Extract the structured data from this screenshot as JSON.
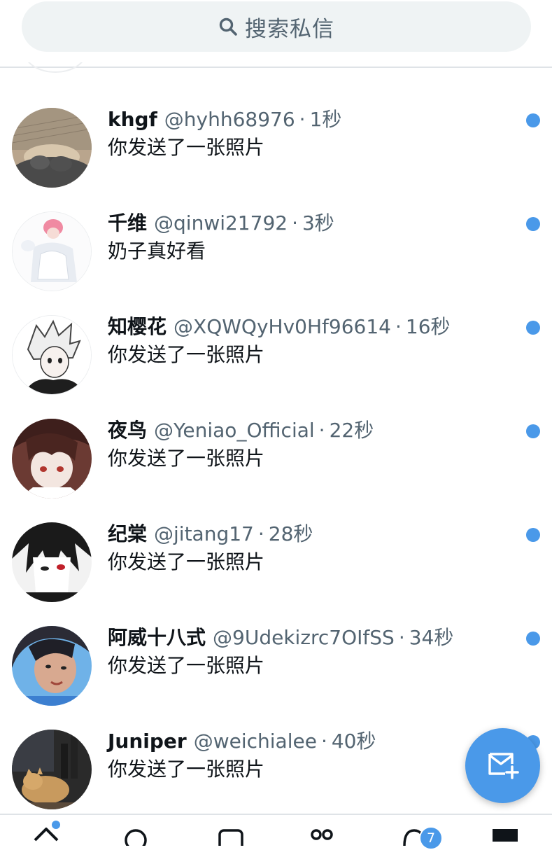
{
  "search": {
    "placeholder": "搜索私信",
    "icon": "search-icon"
  },
  "colors": {
    "accent": "#4a99e9",
    "secondary_text": "#536471",
    "primary_text": "#0f1419",
    "search_bg": "#eff3f4"
  },
  "conversations": [
    {
      "name": "khgf",
      "handle": "@hyhh68976",
      "sep": "·",
      "time": "1秒",
      "preview": "你发送了一张照片",
      "unread": true
    },
    {
      "name": "千维",
      "handle": "@qinwi21792",
      "sep": "·",
      "time": "3秒",
      "preview": "奶子真好看",
      "unread": true
    },
    {
      "name": "知樱花",
      "handle": "@XQWQyHv0Hf96614",
      "sep": "·",
      "time": "16秒",
      "preview": "你发送了一张照片",
      "unread": true
    },
    {
      "name": "夜鸟",
      "handle": "@Yeniao_Official",
      "sep": "·",
      "time": "22秒",
      "preview": "你发送了一张照片",
      "unread": true
    },
    {
      "name": "纪棠",
      "handle": "@jitang17",
      "sep": "·",
      "time": "28秒",
      "preview": "你发送了一张照片",
      "unread": true
    },
    {
      "name": "阿威十八式",
      "handle": "@9Udekizrc7OIfSS",
      "sep": "·",
      "time": "34秒",
      "preview": "你发送了一张照片",
      "unread": true
    },
    {
      "name": "Juniper",
      "handle": "@weichialee",
      "sep": "·",
      "time": "40秒",
      "preview": "你发送了一张照片",
      "unread": true
    }
  ],
  "compose": {
    "icon": "new-message-icon"
  },
  "bottom_nav": {
    "items": [
      "home-icon",
      "search-icon",
      "spaces-icon",
      "communities-icon",
      "notifications-icon",
      "messages-icon"
    ],
    "notifications_badge": "7"
  }
}
